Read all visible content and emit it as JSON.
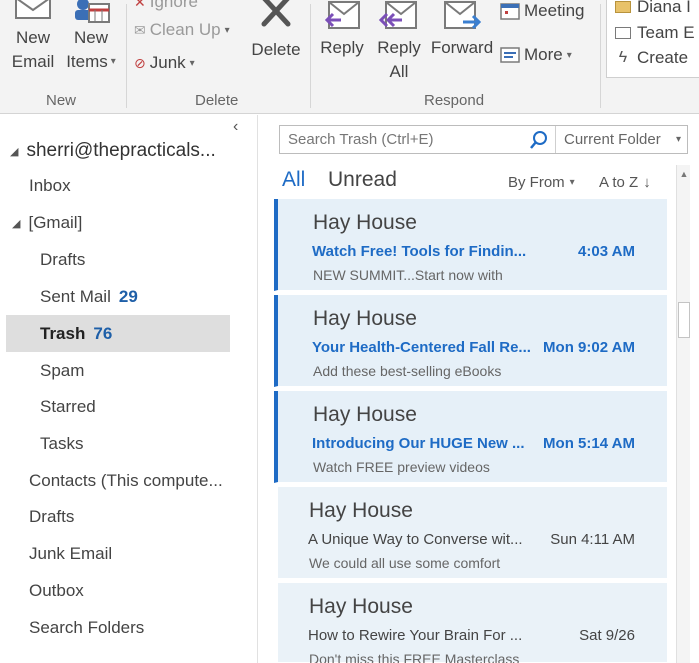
{
  "ribbon": {
    "new_email_line1": "New",
    "new_email_line2": "Email",
    "new_items_line1": "New",
    "new_items_line2": "Items",
    "ignore": "Ignore",
    "clean_up": "Clean Up",
    "junk": "Junk",
    "delete": "Delete",
    "reply": "Reply",
    "reply_all_line1": "Reply",
    "reply_all_line2": "All",
    "forward": "Forward",
    "meeting": "Meeting",
    "more": "More",
    "quick_steps": [
      "Diana I",
      "Team E",
      "Create"
    ],
    "groups": {
      "new": "New",
      "delete": "Delete",
      "respond": "Respond"
    }
  },
  "folders": {
    "account": "sherri@thepracticals...",
    "inbox": "Inbox",
    "gmail": "[Gmail]",
    "gmail_children": [
      {
        "label": "Drafts",
        "count": ""
      },
      {
        "label": "Sent Mail",
        "count": "29"
      },
      {
        "label": "Trash",
        "count": "76"
      },
      {
        "label": "Spam",
        "count": ""
      },
      {
        "label": "Starred",
        "count": ""
      },
      {
        "label": "Tasks",
        "count": ""
      }
    ],
    "root_items": [
      "Contacts (This compute...",
      "Drafts",
      "Junk Email",
      "Outbox",
      "Search Folders"
    ]
  },
  "search": {
    "placeholder": "Search Trash (Ctrl+E)",
    "scope": "Current Folder"
  },
  "filters": {
    "all": "All",
    "unread": "Unread",
    "sort_by": "By From",
    "sort_order": "A to Z"
  },
  "messages": [
    {
      "sender": "Hay House",
      "subject": "Watch Free! Tools for Findin...",
      "time": "4:03 AM",
      "preview": "NEW SUMMIT...Start now with",
      "unread": true
    },
    {
      "sender": "Hay House",
      "subject": "Your Health-Centered Fall Re...",
      "time": "Mon 9:02 AM",
      "preview": "Add these best-selling eBooks",
      "unread": true
    },
    {
      "sender": "Hay House",
      "subject": "Introducing Our HUGE New ...",
      "time": "Mon 5:14 AM",
      "preview": "Watch FREE preview videos",
      "unread": true
    },
    {
      "sender": "Hay House",
      "subject": "A Unique Way to Converse wit...",
      "time": "Sun 4:11 AM",
      "preview": "We could all use some comfort",
      "unread": false
    },
    {
      "sender": "Hay House",
      "subject": "How to Rewire Your Brain For ...",
      "time": "Sat 9/26",
      "preview": "Don't miss this FREE Masterclass",
      "unread": false
    }
  ],
  "colors": {
    "accent": "#1e6bc5",
    "count": "#1e5fa8",
    "selected_folder_bg": "#dedede",
    "message_bg": "#eaf2f8",
    "ribbon_bg": "#f3f3f3"
  }
}
